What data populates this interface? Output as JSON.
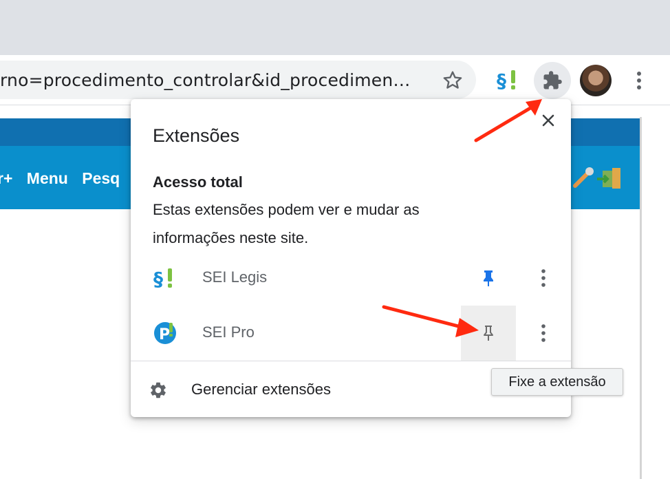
{
  "browser": {
    "url_text": "rno=procedimento_controlar&id_procedimen…",
    "toolbar_icons": [
      "star-icon",
      "sei-legis-extension-icon",
      "puzzle-icon",
      "avatar",
      "kebab-menu-icon"
    ]
  },
  "page": {
    "menu_items": [
      "r+",
      "Menu",
      "Pesq"
    ]
  },
  "popup": {
    "title": "Extensões",
    "section_title": "Acesso total",
    "description": "Estas extensões podem ver e mudar as informações neste site.",
    "extensions": [
      {
        "name": "SEI Legis",
        "pinned": true
      },
      {
        "name": "SEI Pro",
        "pinned": false
      }
    ],
    "manage_label": "Gerenciar extensões"
  },
  "tooltip": {
    "text": "Fixe a extensão"
  },
  "colors": {
    "accent": "#1a73e8",
    "header_blue": "#0a8fcc",
    "annotation_red": "#ff2a10"
  }
}
